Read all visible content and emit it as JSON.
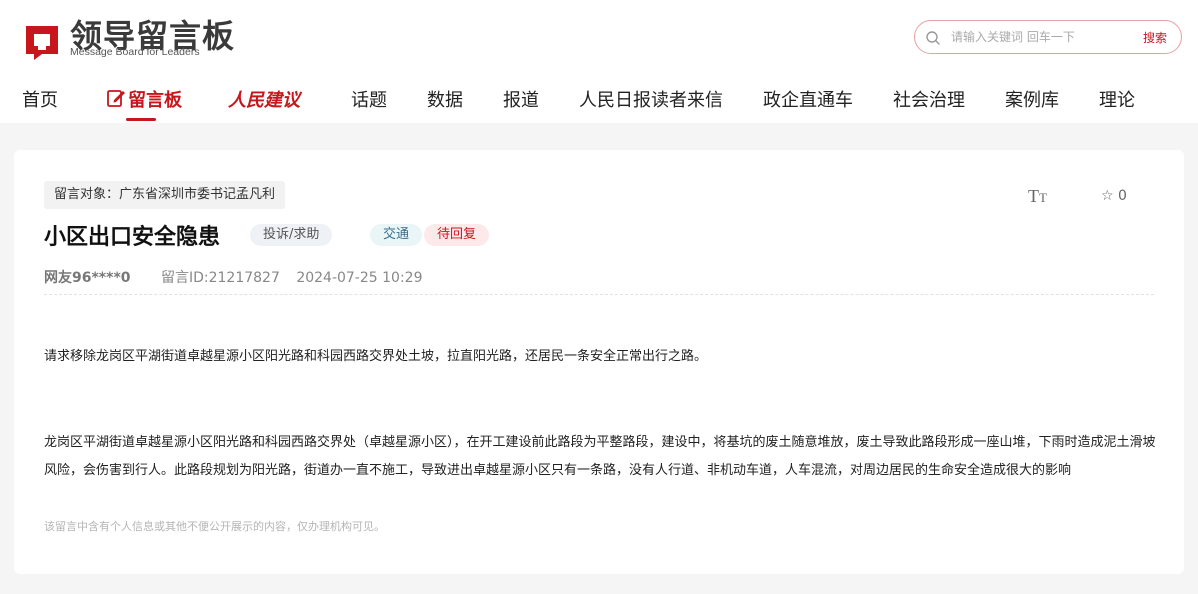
{
  "logo": {
    "title": "领导留言板",
    "subtitle": "Message Board for Leaders",
    "icon": "logo-mark-icon",
    "brand_color": "#c8161d"
  },
  "search": {
    "placeholder": "请输入关键词 回车一下",
    "button_label": "搜索"
  },
  "nav": {
    "items": [
      {
        "label": "首页"
      },
      {
        "label": "留言板",
        "active": true,
        "icon": "note-pen-icon"
      },
      {
        "label": "人民建议"
      },
      {
        "label": "话题"
      },
      {
        "label": "数据"
      },
      {
        "label": "报道"
      },
      {
        "label": "人民日报读者来信"
      },
      {
        "label": "政企直通车"
      },
      {
        "label": "社会治理"
      },
      {
        "label": "案例库"
      },
      {
        "label": "理论"
      }
    ]
  },
  "message": {
    "target": "留言对象：广东省深圳市委书记孟凡利",
    "title": "小区出口安全隐患",
    "tags": {
      "type": "投诉/求助",
      "category": "交通",
      "status": "待回复"
    },
    "user": "网友96****0",
    "id_label": "留言ID:21217827",
    "time": "2024-07-25 10:29",
    "font_toggle_icon": "font-size-icon",
    "favorite_icon": "star-outline-icon",
    "favorite_count": "0",
    "summary": "请求移除龙岗区平湖街道卓越星源小区阳光路和科园西路交界处土坡，拉直阳光路，还居民一条安全正常出行之路。",
    "detail": "龙岗区平湖街道卓越星源小区阳光路和科园西路交界处（卓越星源小区），在开工建设前此路段为平整路段，建设中，将基坑的废土随意堆放，废土导致此路段形成一座山堆，下雨时造成泥土滑坡风险，会伤害到行人。此路段规划为阳光路，街道办一直不施工，导致进出卓越星源小区只有一条路，没有人行道、非机动车道，人车混流，对周边居民的生命安全造成很大的影响",
    "privacy_notice": "该留言中含有个人信息或其他不便公开展示的内容，仅办理机构可见。"
  }
}
